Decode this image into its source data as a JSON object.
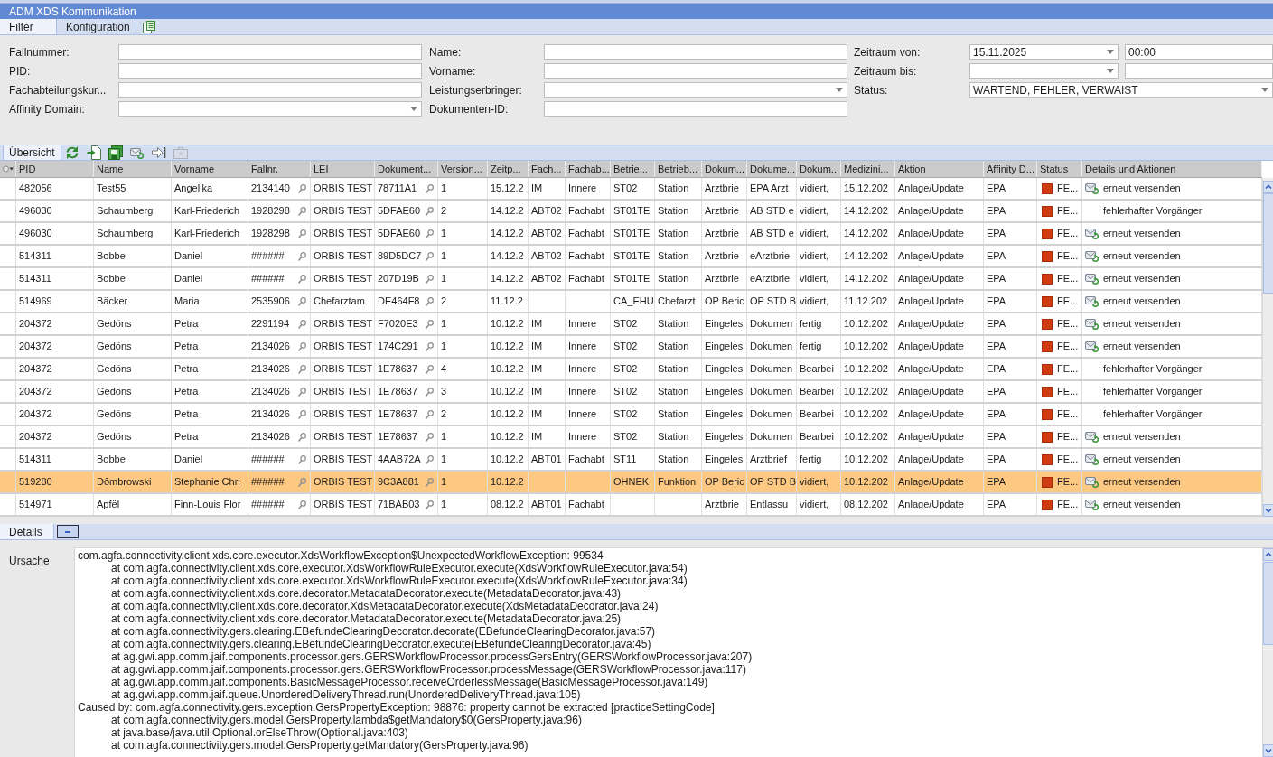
{
  "window": {
    "title": "ADM XDS Kommunikation"
  },
  "tabs": [
    {
      "label": "Filter",
      "selected": true
    },
    {
      "label": "Konfiguration",
      "selected": false
    }
  ],
  "filter": {
    "rows": [
      [
        {
          "label": "Fallnummer:",
          "kind": "text"
        },
        {
          "label": "Name:",
          "kind": "text"
        },
        {
          "label": "Zeitraum von:",
          "kind": "datetime",
          "value": "15.11.2025",
          "time": "00:00"
        }
      ],
      [
        {
          "label": "PID:",
          "kind": "text"
        },
        {
          "label": "Vorname:",
          "kind": "text"
        },
        {
          "label": "Zeitraum bis:",
          "kind": "datetime"
        }
      ],
      [
        {
          "label": "Fachabteilungskur...",
          "kind": "text"
        },
        {
          "label": "Leistungserbringer:",
          "kind": "combo"
        },
        {
          "label": "Status:",
          "kind": "combo",
          "value": "WARTEND, FEHLER, VERWAIST"
        }
      ],
      [
        {
          "label": "Affinity Domain:",
          "kind": "combo"
        },
        {
          "label": "Dokumenten-ID:",
          "kind": "text"
        }
      ]
    ]
  },
  "overview": {
    "tabs": [
      {
        "label": "Übersicht",
        "selected": true
      }
    ],
    "toolbar": [
      {
        "disabled": false
      },
      {
        "disabled": false
      },
      {
        "disabled": false
      },
      {
        "disabled": false
      },
      {
        "disabled": false
      },
      {
        "disabled": true
      }
    ]
  },
  "table": {
    "columns": [
      {
        "label": "PID",
        "kind": "text"
      },
      {
        "label": "Name",
        "kind": "text"
      },
      {
        "label": "Vorname",
        "kind": "text"
      },
      {
        "label": "Fallnr.",
        "kind": "lookup"
      },
      {
        "label": "LEI",
        "kind": "text"
      },
      {
        "label": "Dokument...",
        "kind": "lookup"
      },
      {
        "label": "Version...",
        "kind": "text"
      },
      {
        "label": "Zeitp...",
        "kind": "text"
      },
      {
        "label": "Fach...",
        "kind": "text"
      },
      {
        "label": "Fachab...",
        "kind": "text"
      },
      {
        "label": "Betrie...",
        "kind": "text"
      },
      {
        "label": "Betrieb...",
        "kind": "text"
      },
      {
        "label": "Dokum...",
        "kind": "text"
      },
      {
        "label": "Dokume...",
        "kind": "text"
      },
      {
        "label": "Dokum...",
        "kind": "text"
      },
      {
        "label": "Medizini...",
        "kind": "text"
      },
      {
        "label": "Aktion",
        "kind": "text"
      },
      {
        "label": "Affinity D...",
        "kind": "text"
      },
      {
        "label": "Status",
        "kind": "status"
      },
      {
        "label": "Details und Aktionen",
        "kind": "action"
      }
    ],
    "rows": [
      {
        "selected": false,
        "cells": [
          "482056",
          "Test55",
          "Angelika",
          "2134140",
          "ORBIS TEST",
          "78711A1",
          "1",
          "15.12.2",
          "IM",
          "Innere",
          "ST02",
          "Station",
          "Arztbrie",
          "EPA Arzt",
          "vidiert,",
          "15.12.202",
          "Anlage/Update",
          "EPA",
          "FE..."
        ],
        "action": {
          "kind": "resend",
          "label": "erneut versenden"
        }
      },
      {
        "selected": false,
        "cells": [
          "496030",
          "Schaumberg",
          "Karl-Friederich",
          "1928298",
          "ORBIS TEST",
          "5DFAE60",
          "2",
          "14.12.2",
          "ABT02",
          "Fachabt",
          "ST01TE",
          "Station",
          "Arztbrie",
          "AB STD e",
          "vidiert,",
          "14.12.202",
          "Anlage/Update",
          "EPA",
          "FE..."
        ],
        "action": {
          "kind": "note",
          "label": "fehlerhafter Vorgänger"
        }
      },
      {
        "selected": false,
        "cells": [
          "496030",
          "Schaumberg",
          "Karl-Friederich",
          "1928298",
          "ORBIS TEST",
          "5DFAE60",
          "1",
          "14.12.2",
          "ABT02",
          "Fachabt",
          "ST01TE",
          "Station",
          "Arztbrie",
          "AB STD e",
          "vidiert,",
          "14.12.202",
          "Anlage/Update",
          "EPA",
          "FE..."
        ],
        "action": {
          "kind": "resend",
          "label": "erneut versenden"
        }
      },
      {
        "selected": false,
        "cells": [
          "514311",
          "Bobbe",
          "Daniel",
          "######",
          "ORBIS TEST",
          "89D5DC7",
          "1",
          "14.12.2",
          "ABT02",
          "Fachabt",
          "ST01TE",
          "Station",
          "Arztbrie",
          "eArztbrie",
          "vidiert,",
          "14.12.202",
          "Anlage/Update",
          "EPA",
          "FE..."
        ],
        "action": {
          "kind": "resend",
          "label": "erneut versenden"
        }
      },
      {
        "selected": false,
        "cells": [
          "514311",
          "Bobbe",
          "Daniel",
          "######",
          "ORBIS TEST",
          "207D19B",
          "1",
          "14.12.2",
          "ABT02",
          "Fachabt",
          "ST01TE",
          "Station",
          "Arztbrie",
          "eArztbrie",
          "vidiert,",
          "14.12.202",
          "Anlage/Update",
          "EPA",
          "FE..."
        ],
        "action": {
          "kind": "resend",
          "label": "erneut versenden"
        }
      },
      {
        "selected": false,
        "cells": [
          "514969",
          "Bäcker",
          "Maria",
          "2535906",
          "Chefarztam",
          "DE464F8",
          "2",
          "11.12.2",
          null,
          null,
          "CA_EHU",
          "Chefarzt",
          "OP Beric",
          "OP STD B",
          "vidiert,",
          "11.12.202",
          "Anlage/Update",
          "EPA",
          "FE..."
        ],
        "action": {
          "kind": "resend",
          "label": "erneut versenden"
        }
      },
      {
        "selected": false,
        "cells": [
          "204372",
          "Gedöns",
          "Petra",
          "2291194",
          "ORBIS TEST",
          "F7020E3",
          "1",
          "10.12.2",
          "IM",
          "Innere",
          "ST02",
          "Station",
          "Eingeles",
          "Dokumen",
          "fertig",
          "10.12.202",
          "Anlage/Update",
          "EPA",
          "FE..."
        ],
        "action": {
          "kind": "resend",
          "label": "erneut versenden"
        }
      },
      {
        "selected": false,
        "cells": [
          "204372",
          "Gedöns",
          "Petra",
          "2134026",
          "ORBIS TEST",
          "174C291",
          "1",
          "10.12.2",
          "IM",
          "Innere",
          "ST02",
          "Station",
          "Eingeles",
          "Dokumen",
          "fertig",
          "10.12.202",
          "Anlage/Update",
          "EPA",
          "FE..."
        ],
        "action": {
          "kind": "resend",
          "label": "erneut versenden"
        }
      },
      {
        "selected": false,
        "cells": [
          "204372",
          "Gedöns",
          "Petra",
          "2134026",
          "ORBIS TEST",
          "1E78637",
          "4",
          "10.12.2",
          "IM",
          "Innere",
          "ST02",
          "Station",
          "Eingeles",
          "Dokumen",
          "Bearbei",
          "10.12.202",
          "Anlage/Update",
          "EPA",
          "FE..."
        ],
        "action": {
          "kind": "note",
          "label": "fehlerhafter Vorgänger"
        }
      },
      {
        "selected": false,
        "cells": [
          "204372",
          "Gedöns",
          "Petra",
          "2134026",
          "ORBIS TEST",
          "1E78637",
          "3",
          "10.12.2",
          "IM",
          "Innere",
          "ST02",
          "Station",
          "Eingeles",
          "Dokumen",
          "Bearbei",
          "10.12.202",
          "Anlage/Update",
          "EPA",
          "FE..."
        ],
        "action": {
          "kind": "note",
          "label": "fehlerhafter Vorgänger"
        }
      },
      {
        "selected": false,
        "cells": [
          "204372",
          "Gedöns",
          "Petra",
          "2134026",
          "ORBIS TEST",
          "1E78637",
          "2",
          "10.12.2",
          "IM",
          "Innere",
          "ST02",
          "Station",
          "Eingeles",
          "Dokumen",
          "Bearbei",
          "10.12.202",
          "Anlage/Update",
          "EPA",
          "FE..."
        ],
        "action": {
          "kind": "note",
          "label": "fehlerhafter Vorgänger"
        }
      },
      {
        "selected": false,
        "cells": [
          "204372",
          "Gedöns",
          "Petra",
          "2134026",
          "ORBIS TEST",
          "1E78637",
          "1",
          "10.12.2",
          "IM",
          "Innere",
          "ST02",
          "Station",
          "Eingeles",
          "Dokumen",
          "Bearbei",
          "10.12.202",
          "Anlage/Update",
          "EPA",
          "FE..."
        ],
        "action": {
          "kind": "resend",
          "label": "erneut versenden"
        }
      },
      {
        "selected": false,
        "cells": [
          "514311",
          "Bobbe",
          "Daniel",
          "######",
          "ORBIS TEST",
          "4AAB72A",
          "1",
          "10.12.2",
          "ABT01",
          "Fachabt",
          "ST11",
          "Station",
          "Eingeles",
          "Arztbrief",
          "fertig",
          "10.12.202",
          "Anlage/Update",
          "EPA",
          "FE..."
        ],
        "action": {
          "kind": "resend",
          "label": "erneut versenden"
        }
      },
      {
        "selected": true,
        "cells": [
          "519280",
          "Dômbrowski",
          "Stephanie Chri",
          "######",
          "ORBIS TEST",
          "9C3A881",
          "1",
          "10.12.2",
          null,
          null,
          "OHNEK",
          "Funktion",
          "OP Beric",
          "OP STD B",
          "vidiert,",
          "10.12.202",
          "Anlage/Update",
          "EPA",
          "FE..."
        ],
        "action": {
          "kind": "resend",
          "label": "erneut versenden"
        }
      },
      {
        "selected": false,
        "cells": [
          "514971",
          "Apfël",
          "Finn-Louis Flor",
          "######",
          "ORBIS TEST",
          "71BAB03",
          "1",
          "08.12.2",
          "ABT01",
          "Fachabt",
          null,
          null,
          "Arztbrie",
          "Entlassu",
          "vidiert,",
          "08.12.202",
          "Anlage/Update",
          "EPA",
          "FE..."
        ],
        "action": {
          "kind": "resend",
          "label": "erneut versenden"
        }
      }
    ]
  },
  "details": {
    "tabs": [
      {
        "label": "Details",
        "selected": true
      }
    ],
    "cause_label": "Ursache",
    "lines": [
      {
        "kind": "exception",
        "text": "com.agfa.connectivity.client.xds.core.executor.XdsWorkflowException$UnexpectedWorkflowException: 99534"
      },
      {
        "kind": "frame",
        "text": "at com.agfa.connectivity.client.xds.core.executor.XdsWorkflowRuleExecutor.execute(XdsWorkflowRuleExecutor.java:54)"
      },
      {
        "kind": "frame",
        "text": "at com.agfa.connectivity.client.xds.core.executor.XdsWorkflowRuleExecutor.execute(XdsWorkflowRuleExecutor.java:34)"
      },
      {
        "kind": "frame",
        "text": "at com.agfa.connectivity.client.xds.core.decorator.MetadataDecorator.execute(MetadataDecorator.java:43)"
      },
      {
        "kind": "frame",
        "text": "at com.agfa.connectivity.client.xds.core.decorator.XdsMetadataDecorator.execute(XdsMetadataDecorator.java:24)"
      },
      {
        "kind": "frame",
        "text": "at com.agfa.connectivity.client.xds.core.decorator.MetadataDecorator.execute(MetadataDecorator.java:25)"
      },
      {
        "kind": "frame",
        "text": "at com.agfa.connectivity.gers.clearing.EBefundeClearingDecorator.decorate(EBefundeClearingDecorator.java:57)"
      },
      {
        "kind": "frame",
        "text": "at com.agfa.connectivity.gers.clearing.EBefundeClearingDecorator.execute(EBefundeClearingDecorator.java:45)"
      },
      {
        "kind": "frame",
        "text": "at ag.gwi.app.comm.jaif.components.processor.gers.GERSWorkflowProcessor.processGersEntry(GERSWorkflowProcessor.java:207)"
      },
      {
        "kind": "frame",
        "text": "at ag.gwi.app.comm.jaif.components.processor.gers.GERSWorkflowProcessor.processMessage(GERSWorkflowProcessor.java:117)"
      },
      {
        "kind": "frame",
        "text": "at ag.gwi.app.comm.jaif.components.BasicMessageProcessor.receiveOrderlessMessage(BasicMessageProcessor.java:149)"
      },
      {
        "kind": "frame",
        "text": "at ag.gwi.app.comm.jaif.queue.UnorderedDeliveryThread.run(UnorderedDeliveryThread.java:105)"
      },
      {
        "kind": "exception",
        "text": "Caused by: com.agfa.connectivity.gers.exception.GersPropertyException: 98876: property cannot be extracted [practiceSettingCode]"
      },
      {
        "kind": "frame",
        "text": "at com.agfa.connectivity.gers.model.GersProperty.lambda$getMandatory$0(GersProperty.java:96)"
      },
      {
        "kind": "frame",
        "text": "at java.base/java.util.Optional.orElseThrow(Optional.java:403)"
      },
      {
        "kind": "frame",
        "text": "at com.agfa.connectivity.gers.model.GersProperty.getMandatory(GersProperty.java:96)"
      }
    ]
  }
}
